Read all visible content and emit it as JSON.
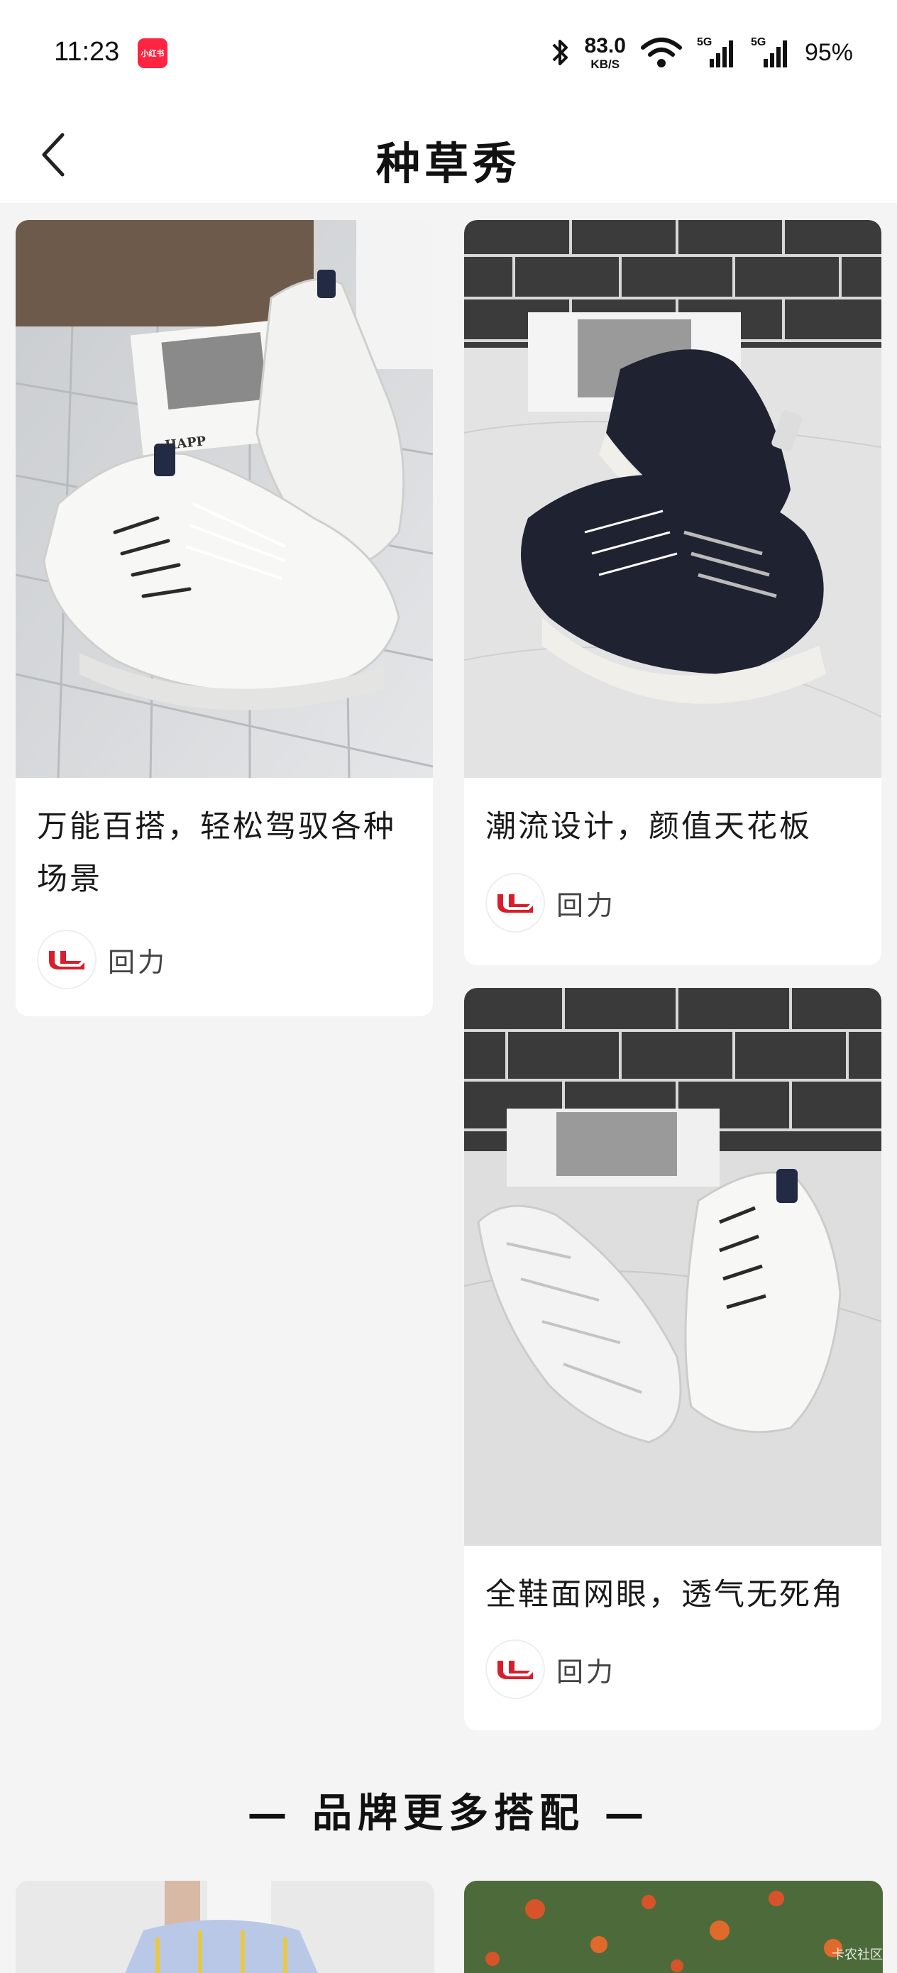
{
  "status_bar": {
    "time": "11:23",
    "app_badge": "小红书",
    "net_speed": "83.0",
    "net_unit": "KB/S",
    "sim1": "5G",
    "sim2": "5G",
    "battery": "95%"
  },
  "nav": {
    "title": "种草秀",
    "back_icon": "chevron-left-icon"
  },
  "cards": [
    {
      "caption": "万能百搭，轻松驾驭各种场景",
      "brand": "回力",
      "image": "white-sneakers-on-wood-floor"
    },
    {
      "caption": "潮流设计，颜值天花板",
      "brand": "回力",
      "image": "black-sneakers-on-marble"
    },
    {
      "caption": "全鞋面网眼，透气无死角",
      "brand": "回力",
      "image": "white-sneakers-on-marble"
    }
  ],
  "section_title": "— 品牌更多搭配 —",
  "watermark": "卡农社区",
  "colors": {
    "brand_red": "#d81e2a",
    "badge_red": "#ff2442",
    "background": "#f4f4f5"
  }
}
